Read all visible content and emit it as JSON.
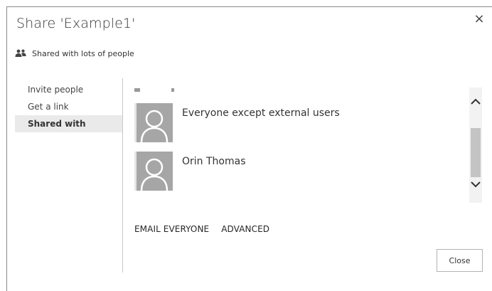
{
  "dialog": {
    "title": "Share 'Example1'",
    "close_glyph": "×",
    "shared_status": {
      "icon": "people-icon",
      "text": "Shared with lots of people"
    }
  },
  "nav": {
    "items": [
      {
        "label": "Invite people",
        "selected": false
      },
      {
        "label": "Get a link",
        "selected": false
      },
      {
        "label": "Shared with",
        "selected": true
      }
    ]
  },
  "shared_with": {
    "people": [
      {
        "name": "Everyone except external users",
        "avatar": "default-person-icon"
      },
      {
        "name": "Orin Thomas",
        "avatar": "default-person-icon"
      }
    ],
    "actions": {
      "email_everyone": "EMAIL EVERYONE",
      "advanced": "ADVANCED"
    }
  },
  "footer": {
    "close_label": "Close"
  },
  "colors": {
    "avatar_bg": "#a6a6a6",
    "selected_nav_bg": "#eaeaea",
    "scroll_thumb": "#c4c4c4"
  }
}
